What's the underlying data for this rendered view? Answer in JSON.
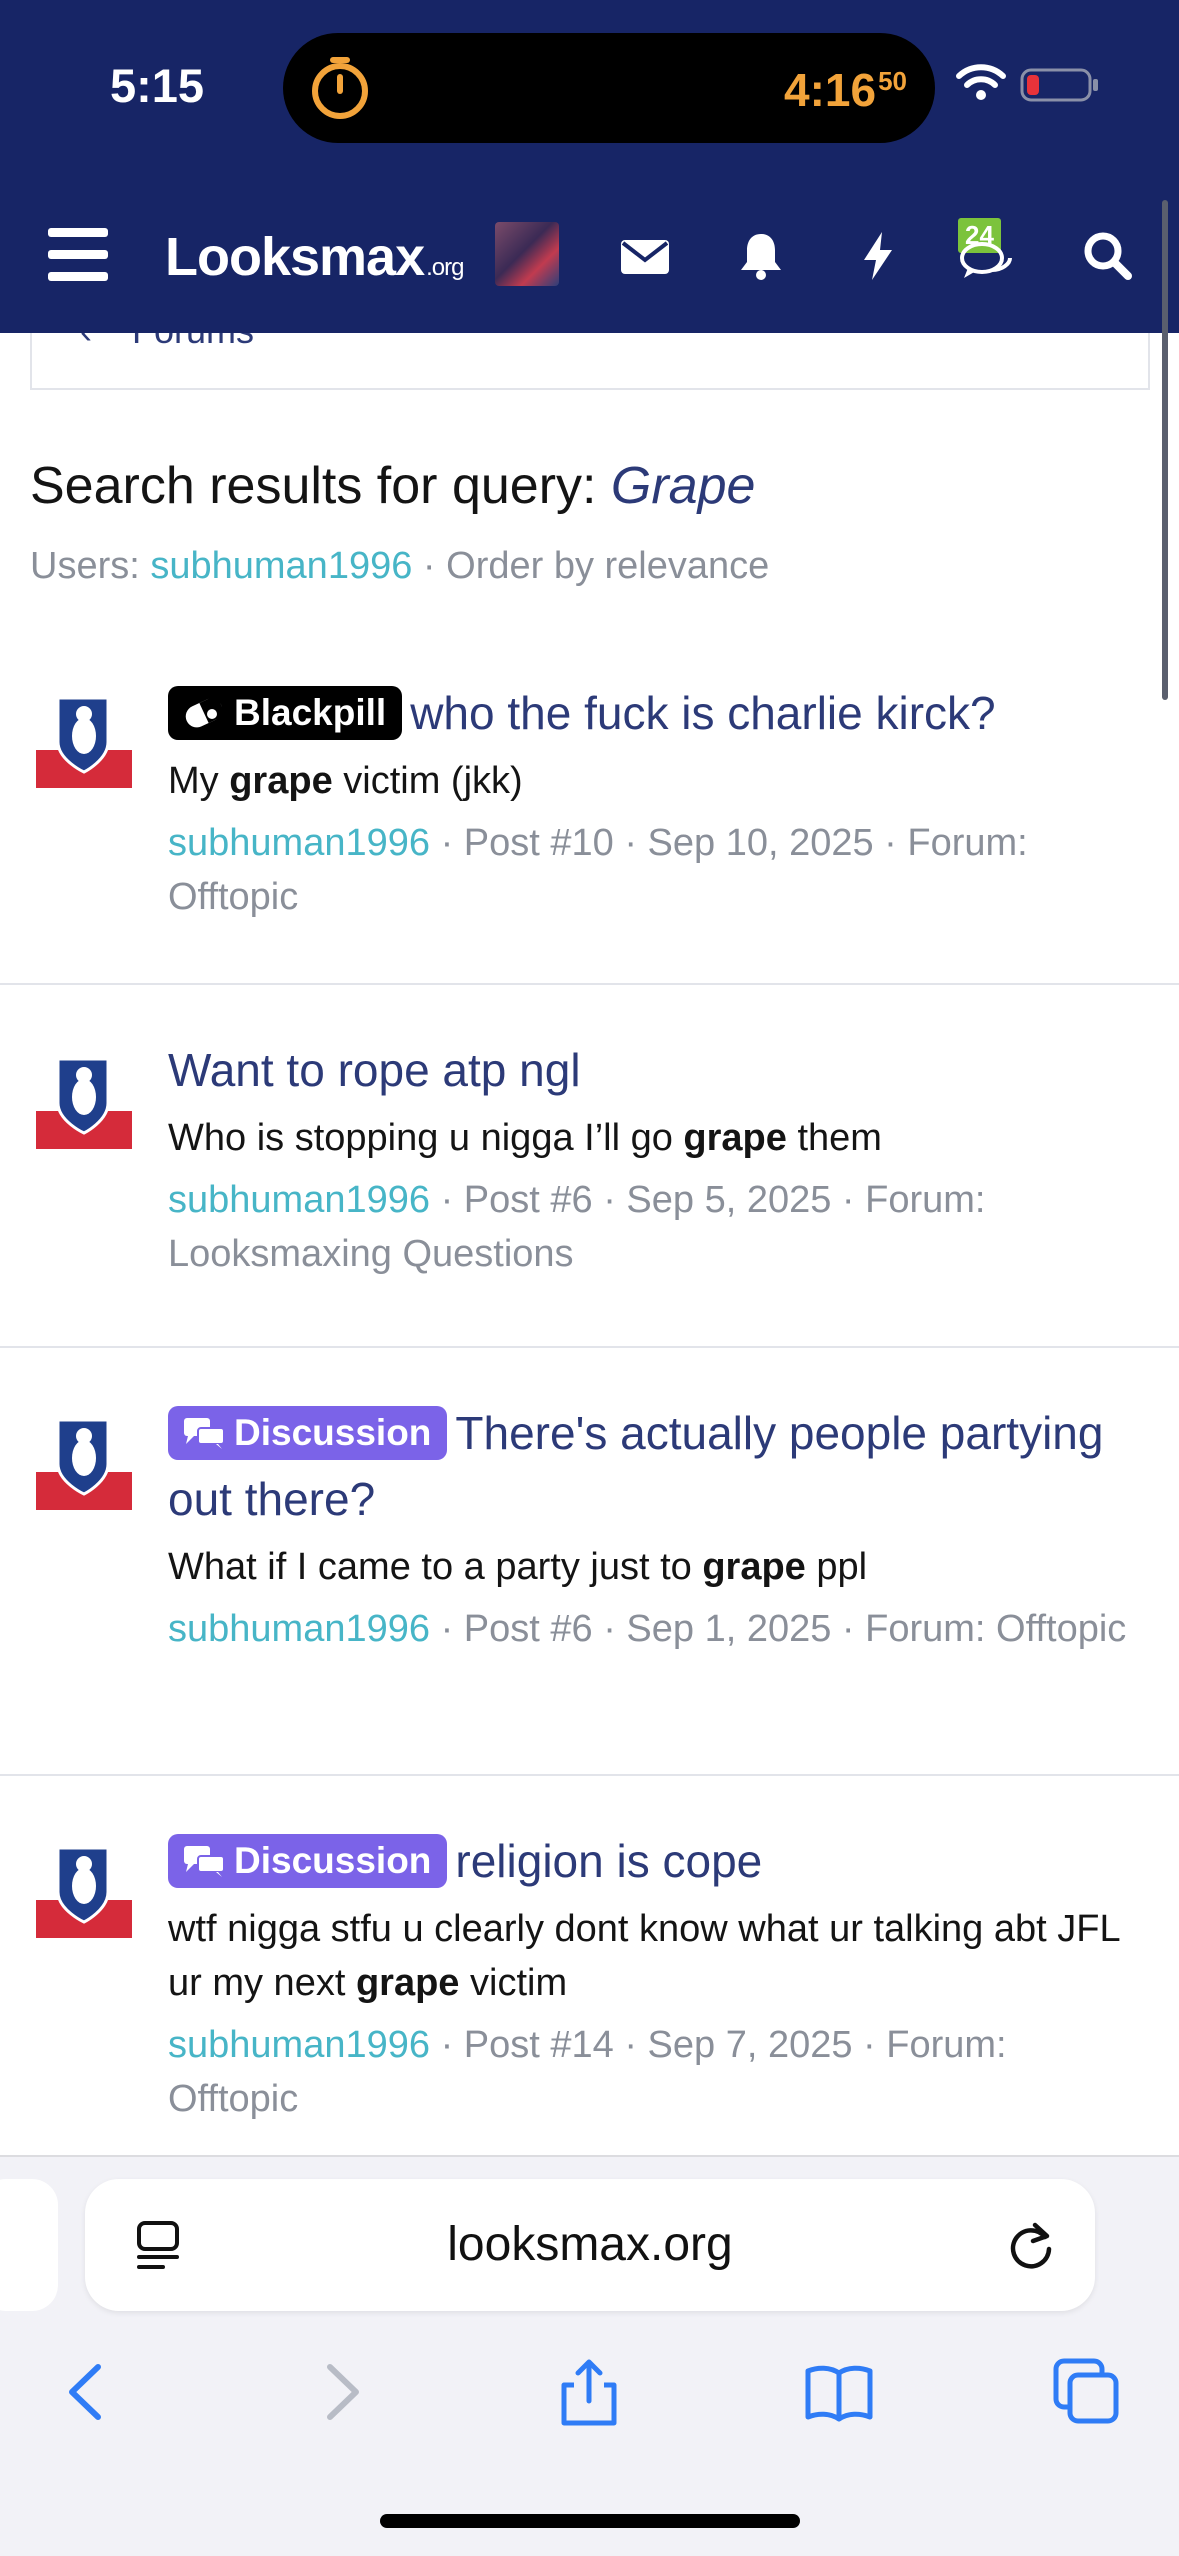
{
  "status_bar": {
    "time": "5:15",
    "timer": "4:16",
    "timer_seconds": "50"
  },
  "nav": {
    "logo": "Looksmax",
    "logo_suffix": ".org",
    "notifications_badge": "24"
  },
  "breadcrumb": {
    "label": "Forums"
  },
  "search": {
    "title_prefix": "Search results for query:",
    "query": "Grape",
    "meta_users_label": "Users:",
    "meta_user": "subhuman1996",
    "meta_order": "· Order by relevance"
  },
  "results": [
    {
      "tag": "Blackpill",
      "title": "who the fuck is charlie kirck?",
      "snippet_before": "My ",
      "snippet_highlight": "grape",
      "snippet_after": " victim (jkk)",
      "user": "subhuman1996",
      "meta": "· Post #10 · Sep 10, 2025 · Forum: Offtopic"
    },
    {
      "tag": "",
      "title": "Want to rope atp ngl",
      "snippet_before": "Who is stopping u nigga I’ll go ",
      "snippet_highlight": "grape",
      "snippet_after": " them",
      "user": "subhuman1996",
      "meta": "· Post #6 · Sep 5, 2025 · Forum: Looksmaxing Questions"
    },
    {
      "tag": "Discussion",
      "title": "There's actually people partying out there?",
      "snippet_before": "What if I came to a party just to ",
      "snippet_highlight": "grape",
      "snippet_after": " ppl",
      "user": "subhuman1996",
      "meta": "· Post #6 · Sep 1, 2025 · Forum: Offtopic"
    },
    {
      "tag": "Discussion",
      "title": "religion is cope",
      "snippet_before": "wtf nigga stfu u clearly dont know what ur talking abt JFL ur my next ",
      "snippet_highlight": "grape",
      "snippet_after": " victim",
      "user": "subhuman1996",
      "meta": "· Post #14 · Sep 7, 2025 · Forum: Offtopic"
    }
  ],
  "safari": {
    "url": "looksmax.org"
  },
  "colors": {
    "header_bg": "#172566",
    "link": "#2c3a78",
    "user_link": "#47b5c7",
    "tag_discussion": "#7b63e8",
    "tag_blackpill": "#000000"
  },
  "icons": [
    "timer-icon",
    "wifi-icon",
    "battery-icon",
    "menu-icon",
    "avatar",
    "mail-icon",
    "bell-icon",
    "bolt-icon",
    "chat-icon",
    "search-icon",
    "back-icon",
    "forward-icon",
    "share-icon",
    "bookmarks-icon",
    "tabs-icon",
    "reader-icon",
    "reload-icon"
  ]
}
